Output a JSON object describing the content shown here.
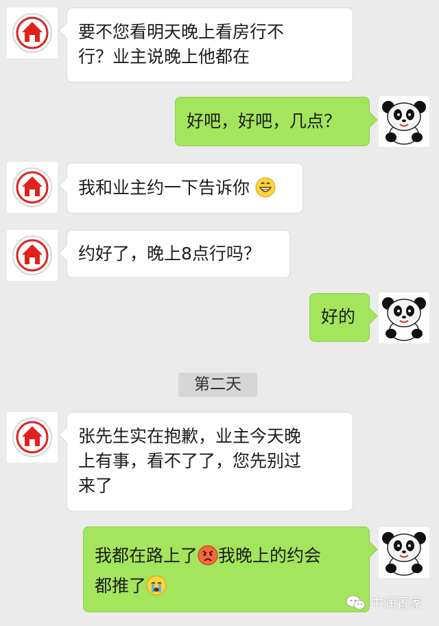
{
  "colors": {
    "background": "#ebebeb",
    "incoming_bubble": "#ffffff",
    "outgoing_bubble": "#a3e55c",
    "house_icon": "#e2211c"
  },
  "messages": [
    {
      "side": "in",
      "avatar": "house-icon",
      "lines": [
        "要不您看明天晚上看房行不",
        "行？业主说晚上他都在"
      ]
    },
    {
      "side": "out",
      "avatar": "panda-avatar",
      "lines": [
        "好吧，好吧，几点？"
      ]
    },
    {
      "side": "in",
      "avatar": "house-icon",
      "lines": [
        "我和业主约一下告诉你"
      ],
      "emoji": "grinning-emoji"
    },
    {
      "side": "in",
      "avatar": "house-icon",
      "lines": [
        "约好了，晚上8点行吗？"
      ]
    },
    {
      "side": "out",
      "avatar": "panda-avatar",
      "lines": [
        "好的"
      ]
    },
    {
      "side": "in",
      "avatar": "house-icon",
      "lines": [
        "张先生实在抱歉，业主今天晚",
        "上有事，看不了了，您先别过",
        "来了"
      ]
    },
    {
      "side": "out",
      "avatar": "panda-avatar",
      "lines": [
        "我都在路上了",
        "我晚上的约会",
        "都推了"
      ],
      "emoji": [
        "angry-emoji",
        "crying-emoji"
      ]
    }
  ],
  "day_divider": "第二天",
  "watermark": {
    "icon": "wechat-icon",
    "text": "中润置家"
  }
}
